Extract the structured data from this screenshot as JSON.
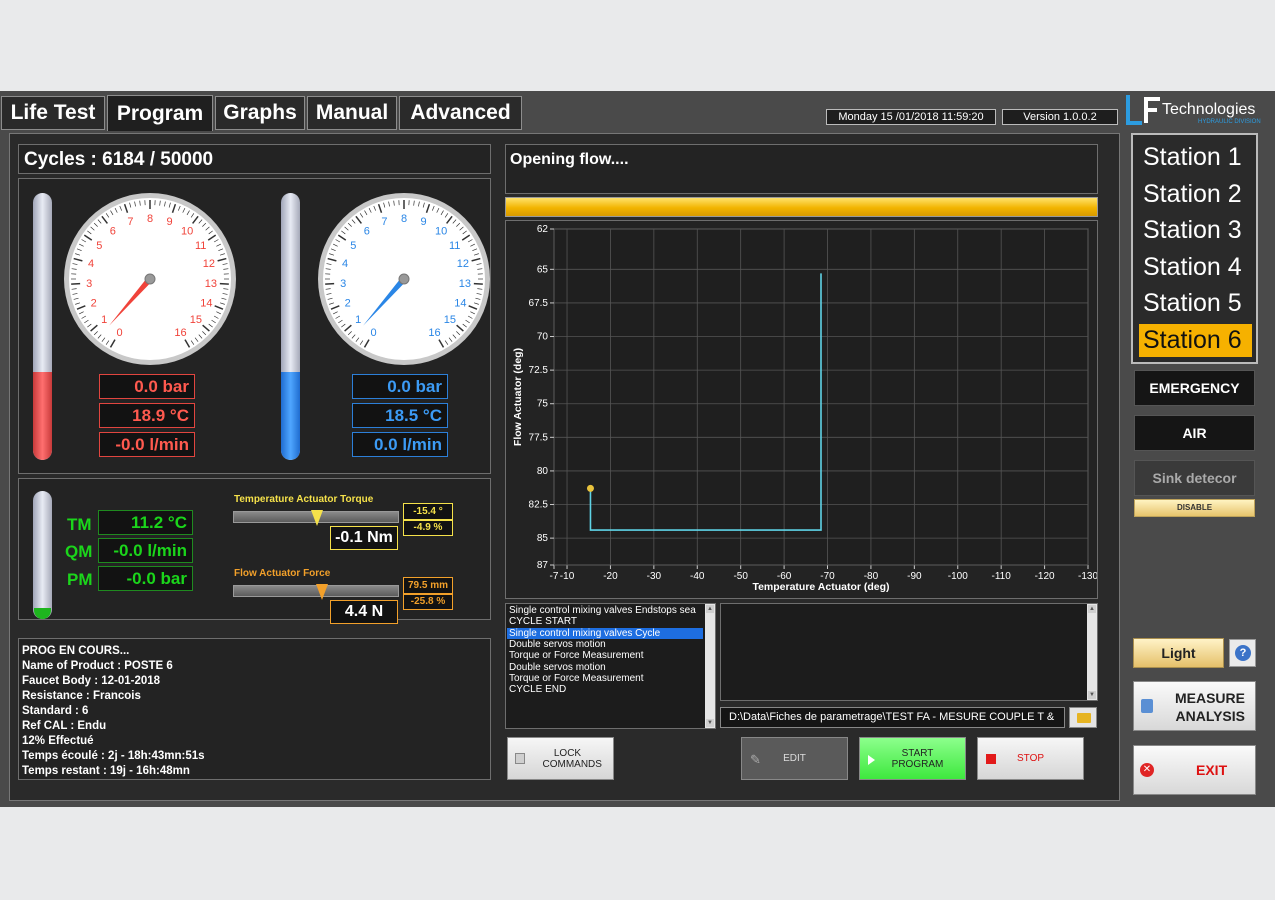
{
  "tabs": [
    "Life Test",
    "Program",
    "Graphs",
    "Manual",
    "Advanced"
  ],
  "header": {
    "datetime": "Monday 15 /01/2018 11:59:20",
    "version": "Version 1.0.0.2",
    "brand": "Technologies",
    "brand_sub": "HYDRAULIC DIVISION"
  },
  "cycles": "Cycles : 6184 / 50000",
  "status": "Opening flow....",
  "gauge_red": {
    "ticks": [
      "0",
      "1",
      "2",
      "3",
      "4",
      "5",
      "6",
      "7",
      "8",
      "9",
      "10",
      "11",
      "12",
      "13",
      "14",
      "15",
      "16"
    ],
    "pressure": "0.0 bar",
    "temperature": "18.9 °C",
    "flow": "-0.0 l/min",
    "level": 0.33,
    "needle_value": 0.6
  },
  "gauge_blue": {
    "ticks": [
      "0",
      "1",
      "2",
      "3",
      "4",
      "5",
      "6",
      "7",
      "8",
      "9",
      "10",
      "11",
      "12",
      "13",
      "14",
      "15",
      "16"
    ],
    "pressure": "0.0 bar",
    "temperature": "18.5 °C",
    "flow": "0.0 l/min",
    "level": 0.33,
    "needle_value": 0.6
  },
  "mixed": {
    "tm_label": "TM",
    "tm_value": "11.2 °C",
    "qm_label": "QM",
    "qm_value": "-0.0 l/min",
    "pm_label": "PM",
    "pm_value": "-0.0 bar"
  },
  "torque": {
    "title": "Temperature Actuator Torque",
    "angle": "-15.4 °",
    "percent": "-4.9 %",
    "value": "-0.1 Nm",
    "slider": 0.5
  },
  "force": {
    "title": "Flow Actuator Force",
    "position": "79.5 mm",
    "percent": "-25.8 %",
    "value": "4.4 N",
    "slider": 0.53
  },
  "info_lines": [
    "PROG EN COURS...",
    "Name of Product : POSTE 6",
    "Faucet Body : 12-01-2018",
    "Resistance : Francois",
    "Standard : 6",
    "Ref CAL : Endu",
    "12%  Effectué",
    "Temps écoulé : 2j - 18h:43mn:51s",
    "Temps restant : 19j - 16h:48mn"
  ],
  "steps": [
    "Single control mixing valves Endstops sea",
    "CYCLE START",
    "Single control mixing valves Cycle",
    "Double servos motion",
    "Torque or Force Measurement",
    "Double servos motion",
    "Torque or Force Measurement",
    "CYCLE END"
  ],
  "selected_step": 2,
  "file_path": "D:\\Data\\Fiches de parametrage\\TEST FA - MESURE COUPLE T &",
  "buttons": {
    "lock": "LOCK COMMANDS",
    "edit": "EDIT",
    "start": "START PROGRAM",
    "stop": "STOP",
    "light": "Light",
    "help": "?",
    "measure": "MEASURE ANALYSIS",
    "exit": "EXIT",
    "disable": "DISABLE"
  },
  "stations": [
    "Station 1",
    "Station 2",
    "Station 3",
    "Station 4",
    "Station 5",
    "Station 6"
  ],
  "active_station": 5,
  "alarms": [
    "EMERGENCY",
    "AIR",
    "Sink detecor"
  ],
  "chart_data": {
    "type": "line",
    "xlabel": "Temperature Actuator (deg)",
    "ylabel": "Flow Actuator (deg)",
    "x_ticks": [
      "-7",
      "-10",
      "-20",
      "-30",
      "-40",
      "-50",
      "-60",
      "-70",
      "-80",
      "-90",
      "-100",
      "-110",
      "-120",
      "-130"
    ],
    "x_tick_values": [
      -7,
      -10,
      -20,
      -30,
      -40,
      -50,
      -60,
      -70,
      -80,
      -90,
      -100,
      -110,
      -120,
      -130
    ],
    "y_ticks": [
      "62",
      "65",
      "67.5",
      "70",
      "72.5",
      "75",
      "77.5",
      "80",
      "82.5",
      "85",
      "87"
    ],
    "y_tick_values": [
      62,
      65,
      67.5,
      70,
      72.5,
      75,
      77.5,
      80,
      82.5,
      85,
      87
    ],
    "xlim": [
      -7,
      -130
    ],
    "ylim": [
      62,
      87
    ],
    "series": [
      {
        "x": [
          -15.4,
          -15.4,
          -68.5,
          -68.5
        ],
        "y": [
          81.3,
          84.4,
          84.4,
          65.3
        ],
        "color": "#5fd3e6"
      }
    ],
    "marker": {
      "x": -15.4,
      "y": 81.3,
      "color": "#e8c23c"
    },
    "grid": true
  }
}
